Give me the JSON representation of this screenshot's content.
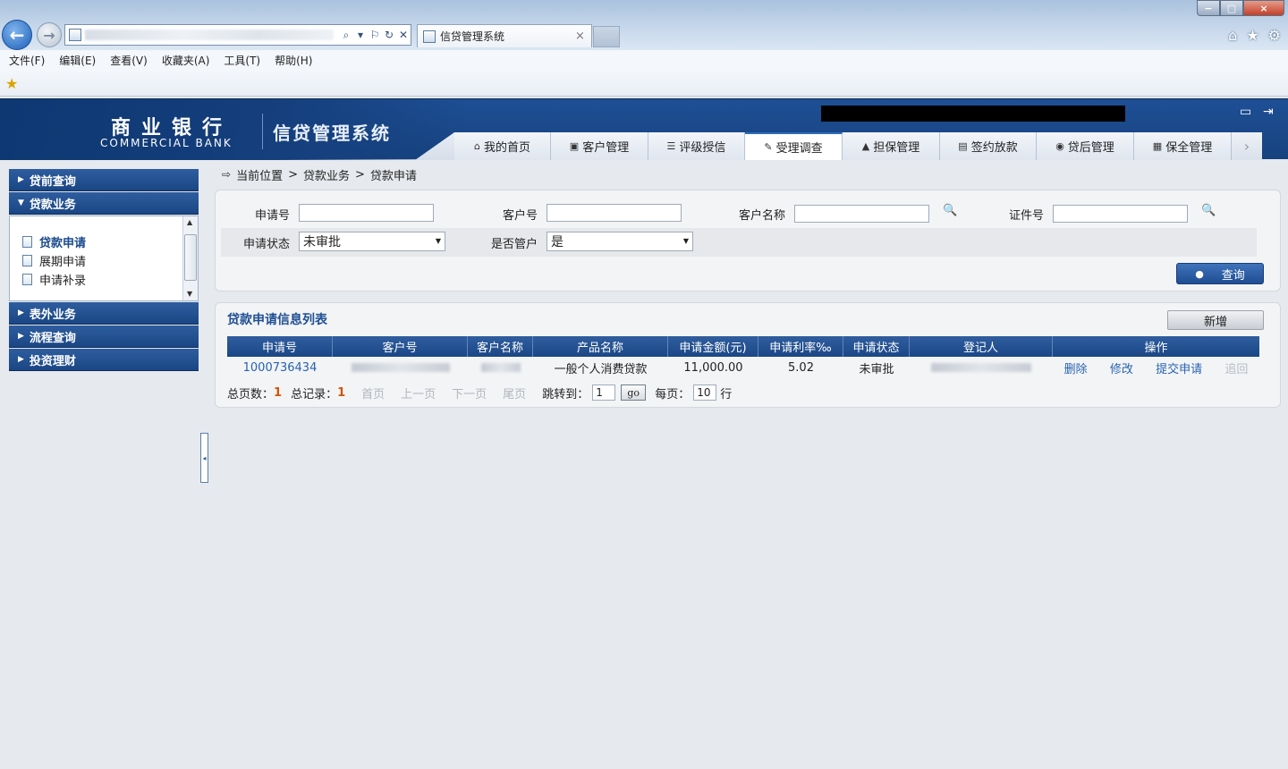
{
  "browser": {
    "tab_title": "信贷管理系统",
    "tab_close": "×",
    "back_glyph": "←",
    "forward_glyph": "→",
    "address_tools": [
      "⌕",
      "▾",
      "⚐",
      "↻",
      "✕"
    ],
    "window_controls": {
      "minimize": "−",
      "maximize": "□",
      "close": "×"
    },
    "right_icons": [
      "⌂",
      "★",
      "⚙"
    ],
    "menu": [
      "文件(F)",
      "编辑(E)",
      "查看(V)",
      "收藏夹(A)",
      "工具(T)",
      "帮助(H)"
    ],
    "favorites_star": "★"
  },
  "header": {
    "bank_name_cn": "商业银行",
    "bank_name_en": "COMMERCIAL BANK",
    "system_name": "信贷管理系统",
    "nav_tabs": [
      {
        "icon": "⌂",
        "label": "我的首页"
      },
      {
        "icon": "▣",
        "label": "客户管理"
      },
      {
        "icon": "☰",
        "label": "评级授信"
      },
      {
        "icon": "✎",
        "label": "受理调查"
      },
      {
        "icon": "▲",
        "label": "担保管理"
      },
      {
        "icon": "▤",
        "label": "签约放款"
      },
      {
        "icon": "◉",
        "label": "贷后管理"
      },
      {
        "icon": "▦",
        "label": "保全管理"
      }
    ],
    "active_tab": 3,
    "more_glyph": "›",
    "monitor_glyph": "▭",
    "logout_glyph": "⇥"
  },
  "sidebar": {
    "groups": [
      "贷前查询",
      "贷款业务",
      "表外业务",
      "流程查询",
      "投资理财"
    ],
    "expanded_group": 1,
    "sub_items": [
      "贷款申请",
      "展期申请",
      "申请补录"
    ],
    "current_item": 0,
    "collapse_glyph": "◂"
  },
  "breadcrumb": {
    "icon": "⇨",
    "items": [
      "当前位置",
      ">",
      "贷款业务",
      ">",
      "贷款申请"
    ]
  },
  "search": {
    "labels": {
      "app_no": "申请号",
      "customer_no": "客户号",
      "customer_name": "客户名称",
      "id_no": "证件号",
      "status": "申请状态",
      "is_manager": "是否管户"
    },
    "values": {
      "app_no": "",
      "customer_no": "",
      "customer_name": "",
      "id_no": ""
    },
    "status_selected": "未审批",
    "is_manager_selected": "是",
    "query_button": "查询",
    "search_glyph": "🔍"
  },
  "list": {
    "title": "贷款申请信息列表",
    "add_button": "新增",
    "columns": [
      "申请号",
      "客户号",
      "客户名称",
      "产品名称",
      "申请金额(元)",
      "申请利率‰",
      "申请状态",
      "登记人",
      "操作"
    ],
    "rows": [
      {
        "app_no": "1000736434",
        "product": "一般个人消费贷款",
        "amount": "11,000.00",
        "rate": "5.02",
        "status": "未审批",
        "actions": [
          "删除",
          "修改",
          "提交申请",
          "追回"
        ]
      }
    ],
    "pager": {
      "total_pages_label": "总页数：",
      "total_pages": "1",
      "total_records_label": "总记录：",
      "total_records": "1",
      "first": "首页",
      "prev": "上一页",
      "next": "下一页",
      "last": "尾页",
      "jump_label": "跳转到：",
      "jump_value": "1",
      "go": "go",
      "per_page_label": "每页：",
      "per_page": "10",
      "per_page_unit": "行"
    }
  }
}
